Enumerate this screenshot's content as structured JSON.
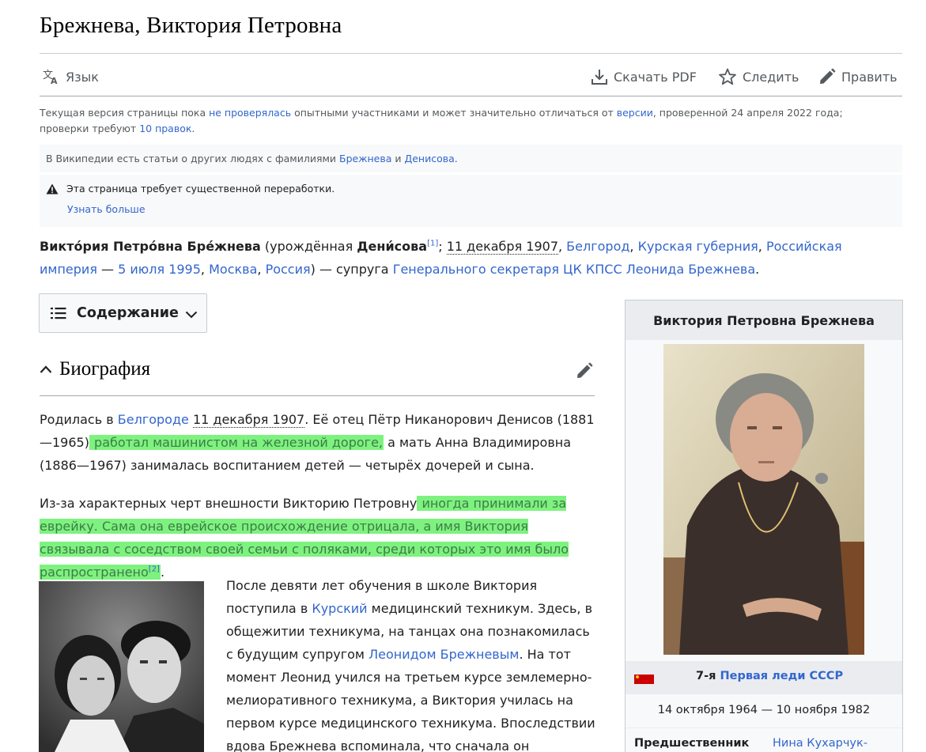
{
  "page": {
    "title": "Брежнева, Виктория Петровна"
  },
  "toolbar": {
    "language": "Язык",
    "download_pdf": "Скачать PDF",
    "watch": "Следить",
    "edit": "Править"
  },
  "flagged_revs": {
    "t1": "Текущая версия страницы пока ",
    "link1": "не проверялась",
    "t2": " опытными участниками и может значительно отличаться от ",
    "link2": "версии",
    "t3": ", проверенной 24 апреля 2022 года; проверки требуют ",
    "link3": "10 правок",
    "t4": "."
  },
  "hatnote": {
    "t1": "В Википедии есть статьи о других людях с фамилиями ",
    "link1": "Брежнева",
    "t2": " и ",
    "link2": "Денисова",
    "t3": "."
  },
  "warning": {
    "text": "Эта страница требует существенной переработки.",
    "learn_more": "Узнать больше"
  },
  "lead": {
    "name": "Викто́рия Петро́вна Бре́жнева",
    "t1": " (урождённая ",
    "maiden": "Дени́сова",
    "ref1": "[1]",
    "t2": "; ",
    "birth_date": "11 декабря 1907",
    "t3": ", ",
    "link_belgorod": "Белгород",
    "t4": ", ",
    "link_kursk": "Курская губерния",
    "t5": ", ",
    "link_empire": "Российская империя",
    "t6": " — ",
    "link_death": "5 июля 1995",
    "t7": ", ",
    "link_moscow": "Москва",
    "t8": ", ",
    "link_russia": "Россия",
    "t9": ") — супруга ",
    "link_spouse": "Генерального секретаря ЦК КПСС Леонида Брежнева",
    "t10": "."
  },
  "toc": {
    "label": "Содержание"
  },
  "section": {
    "title": "Биография"
  },
  "para1": {
    "t1": "Родилась в ",
    "link_belgorod": "Белгороде",
    "t2": " ",
    "birth_date": "11 декабря 1907",
    "t3": ". Её отец Пётр Никанорович Денисов (1881—1965)",
    "hl": " работал машинистом на железной дороге,",
    "t4": " а мать Анна Владимировна (1886—1967) занималась воспитанием детей — четырёх дочерей и сына."
  },
  "para2": {
    "t1": "Из-за характерных черт внешности Викторию Петровну",
    "hl": " иногда принимали за еврейку. Сама она еврейское происхождение отрицала, а имя Виктория связывала с соседством своей семьи с поляками, среди которых это имя было распространено",
    "ref2": "[2]",
    "t2": "."
  },
  "para3": {
    "t1": "После девяти лет обучения в школе Виктория поступила в ",
    "link_kursk": "Курский",
    "t2": " медицинский техникум. Здесь, в общежитии техникума, на танцах она познакомилась с будущим супругом ",
    "link_leonid": "Леонидом Брежневым",
    "t3": ". На тот момент Леонид учился на третьем курсе землемерно-мелиоративного техникума, а Виктория училась на первом курсе медицинского техникума. Впоследствии вдова Брежнева вспоминала, что сначала он пригласил на танцы её"
  },
  "infobox": {
    "caption": "Виктория Петровна Брежнева",
    "office_num": "7-я",
    "office_link": "Первая леди СССР",
    "term": "14 октября 1964 — 10 ноября 1982",
    "predecessor_label": "Предшественник",
    "predecessor_value": "Нина Кухарчук-"
  }
}
